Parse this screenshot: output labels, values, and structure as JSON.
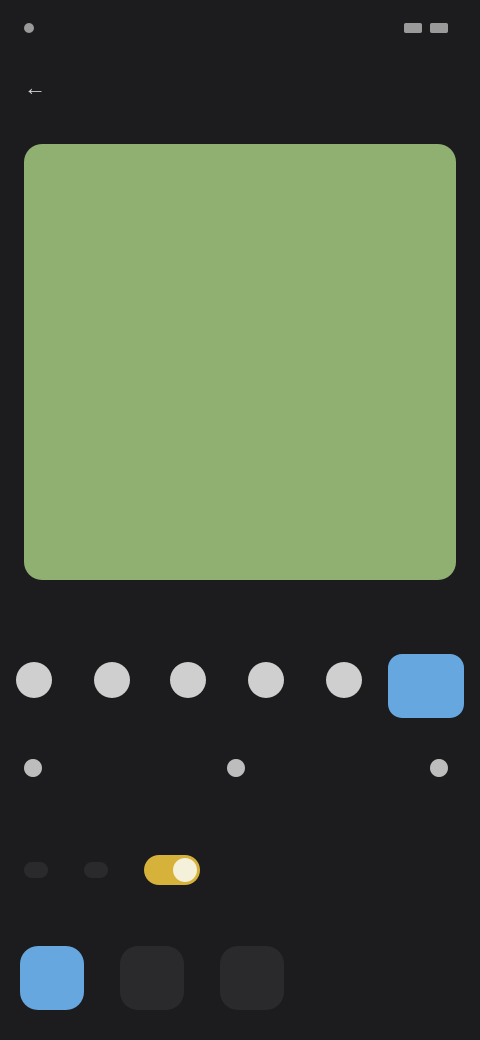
{
  "status": {
    "time": "",
    "right": ""
  },
  "header": {
    "title": "",
    "action": ""
  },
  "canvas": {
    "lines": [
      "",
      "",
      ""
    ],
    "bg": "#8fb070"
  },
  "sections": {
    "color_label": "",
    "options_label": "",
    "size_label": ""
  },
  "colors": {
    "swatches": [
      "#cfcfcf",
      "#cfcfcf",
      "#cfcfcf",
      "#cfcfcf",
      "#cfcfcf",
      "#67a7e0"
    ],
    "selected_index": 5
  },
  "options": [
    "",
    "",
    ""
  ],
  "toggles": {
    "chip1": "",
    "chip2": "",
    "toggle_on": true
  },
  "sizes": [
    "",
    "",
    ""
  ]
}
